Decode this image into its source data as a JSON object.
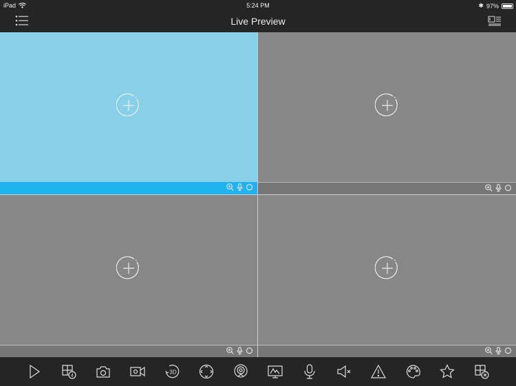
{
  "status_bar": {
    "device": "iPad",
    "time": "5:24 PM",
    "battery": "97%",
    "battery_level": 0.97
  },
  "nav": {
    "title": "Live Preview",
    "left_icon": "menu-list-icon",
    "right_icon": "window-layout-icon"
  },
  "tiles": [
    {
      "selected": true,
      "icon": "add-camera-icon"
    },
    {
      "selected": false,
      "icon": "add-camera-icon"
    },
    {
      "selected": false,
      "icon": "add-camera-icon"
    },
    {
      "selected": false,
      "icon": "add-camera-icon"
    }
  ],
  "tile_controls": [
    "zoom-in-icon",
    "microphone-icon",
    "circle-icon"
  ],
  "toolbar": [
    "play-icon",
    "split-4-icon",
    "snapshot-icon",
    "record-icon",
    "3d-rotate-icon",
    "ptz-icon",
    "fisheye-icon",
    "monitor-icon",
    "microphone-icon",
    "mute-icon",
    "alarm-icon",
    "image-palette-icon",
    "favorite-star-icon",
    "close-all-icon"
  ],
  "colors": {
    "accent": "#1fb3f2",
    "selected_tile": "#87d0e8",
    "tile": "#878787",
    "bar": "#252525"
  }
}
